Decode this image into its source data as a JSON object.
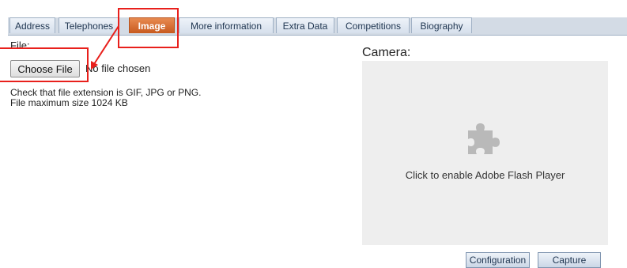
{
  "tabs": [
    {
      "label": "Address"
    },
    {
      "label": "Telephones"
    },
    {
      "label": "Image",
      "active": true
    },
    {
      "label": "More information"
    },
    {
      "label": "Extra Data"
    },
    {
      "label": "Competitions"
    },
    {
      "label": "Biography"
    }
  ],
  "upload": {
    "file_label": "File:",
    "choose_button": "Choose File",
    "status": "No file chosen",
    "hint_line1": "Check that file extension is GIF, JPG or PNG.",
    "hint_line2": "File maximum size 1024 KB"
  },
  "camera": {
    "label": "Camera:",
    "plugin_icon": "puzzle-piece-icon",
    "plugin_message": "Click to enable Adobe Flash Player",
    "config_button": "Configuration",
    "capture_button": "Capture"
  },
  "colors": {
    "active_tab": "#d96d33",
    "tab_bar": "#d3dbe5",
    "annotation": "#e8201c",
    "plugin_placeholder": "#eeeeee"
  }
}
